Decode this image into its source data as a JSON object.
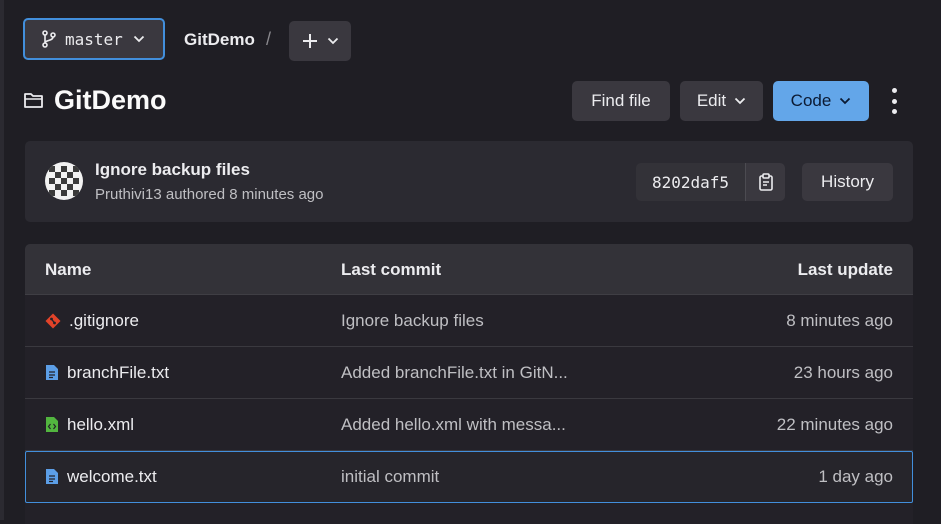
{
  "branch": {
    "name": "master"
  },
  "breadcrumb": {
    "project": "GitDemo",
    "separator": "/"
  },
  "title": "GitDemo",
  "actions": {
    "find_file": "Find file",
    "edit": "Edit",
    "code": "Code"
  },
  "commit": {
    "title": "Ignore backup files",
    "meta": "Pruthivi13 authored 8 minutes ago",
    "sha": "8202daf5",
    "history": "History"
  },
  "table": {
    "headers": {
      "name": "Name",
      "last_commit": "Last commit",
      "last_update": "Last update"
    },
    "rows": [
      {
        "name": ".gitignore",
        "icon": "git-icon",
        "commit": "Ignore backup files",
        "updated": "8 minutes ago"
      },
      {
        "name": "branchFile.txt",
        "icon": "text-file-icon",
        "commit": "Added branchFile.txt in GitN...",
        "updated": "23 hours ago"
      },
      {
        "name": "hello.xml",
        "icon": "xml-file-icon",
        "commit": "Added hello.xml with messa...",
        "updated": "22 minutes ago"
      },
      {
        "name": "welcome.txt",
        "icon": "text-file-icon",
        "commit": "initial commit",
        "updated": "1 day ago"
      }
    ]
  },
  "colors": {
    "accent": "#428fdc",
    "code_button": "#63a6e9",
    "git_icon": "#e24329",
    "xml_icon": "#52b53f",
    "text_icon": "#5c9ee6"
  }
}
